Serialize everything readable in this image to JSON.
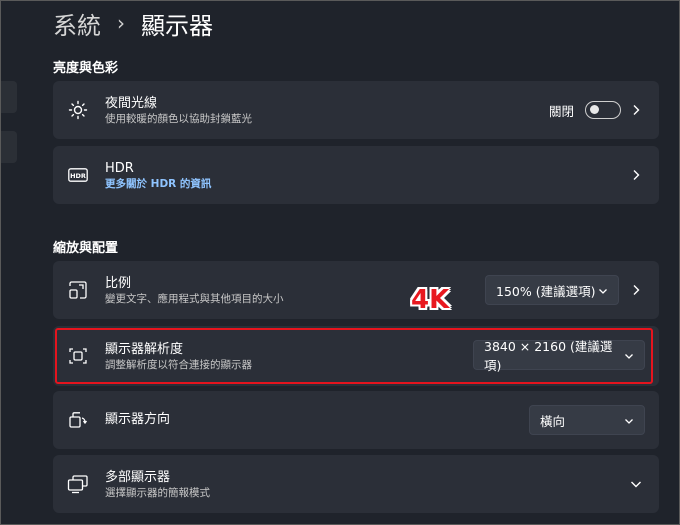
{
  "breadcrumb": {
    "parent": "系統",
    "separator": "›",
    "current": "顯示器"
  },
  "sections": {
    "brightness_color": "亮度與色彩",
    "scale_layout": "縮放與配置"
  },
  "night_light": {
    "title": "夜間光線",
    "subtitle": "使用較暖的顏色以協助封鎖藍光",
    "toggle_label": "關閉",
    "toggle_on": false,
    "icon": "brightness-icon"
  },
  "hdr": {
    "title": "HDR",
    "subtitle": "更多關於 HDR 的資訊",
    "icon": "hdr-icon"
  },
  "scale": {
    "title": "比例",
    "subtitle": "變更文字、應用程式與其他項目的大小",
    "value": "150% (建議選項)",
    "icon": "scale-icon"
  },
  "resolution": {
    "title": "顯示器解析度",
    "subtitle": "調整解析度以符合連接的顯示器",
    "value": "3840 × 2160 (建議選項)",
    "icon": "resolution-icon"
  },
  "orientation": {
    "title": "顯示器方向",
    "value": "橫向",
    "icon": "orientation-icon"
  },
  "multi_display": {
    "title": "多部顯示器",
    "subtitle": "選擇顯示器的簡報模式",
    "icon": "multi-display-icon"
  },
  "annotation": {
    "label": "4K",
    "color": "#e5141e"
  }
}
